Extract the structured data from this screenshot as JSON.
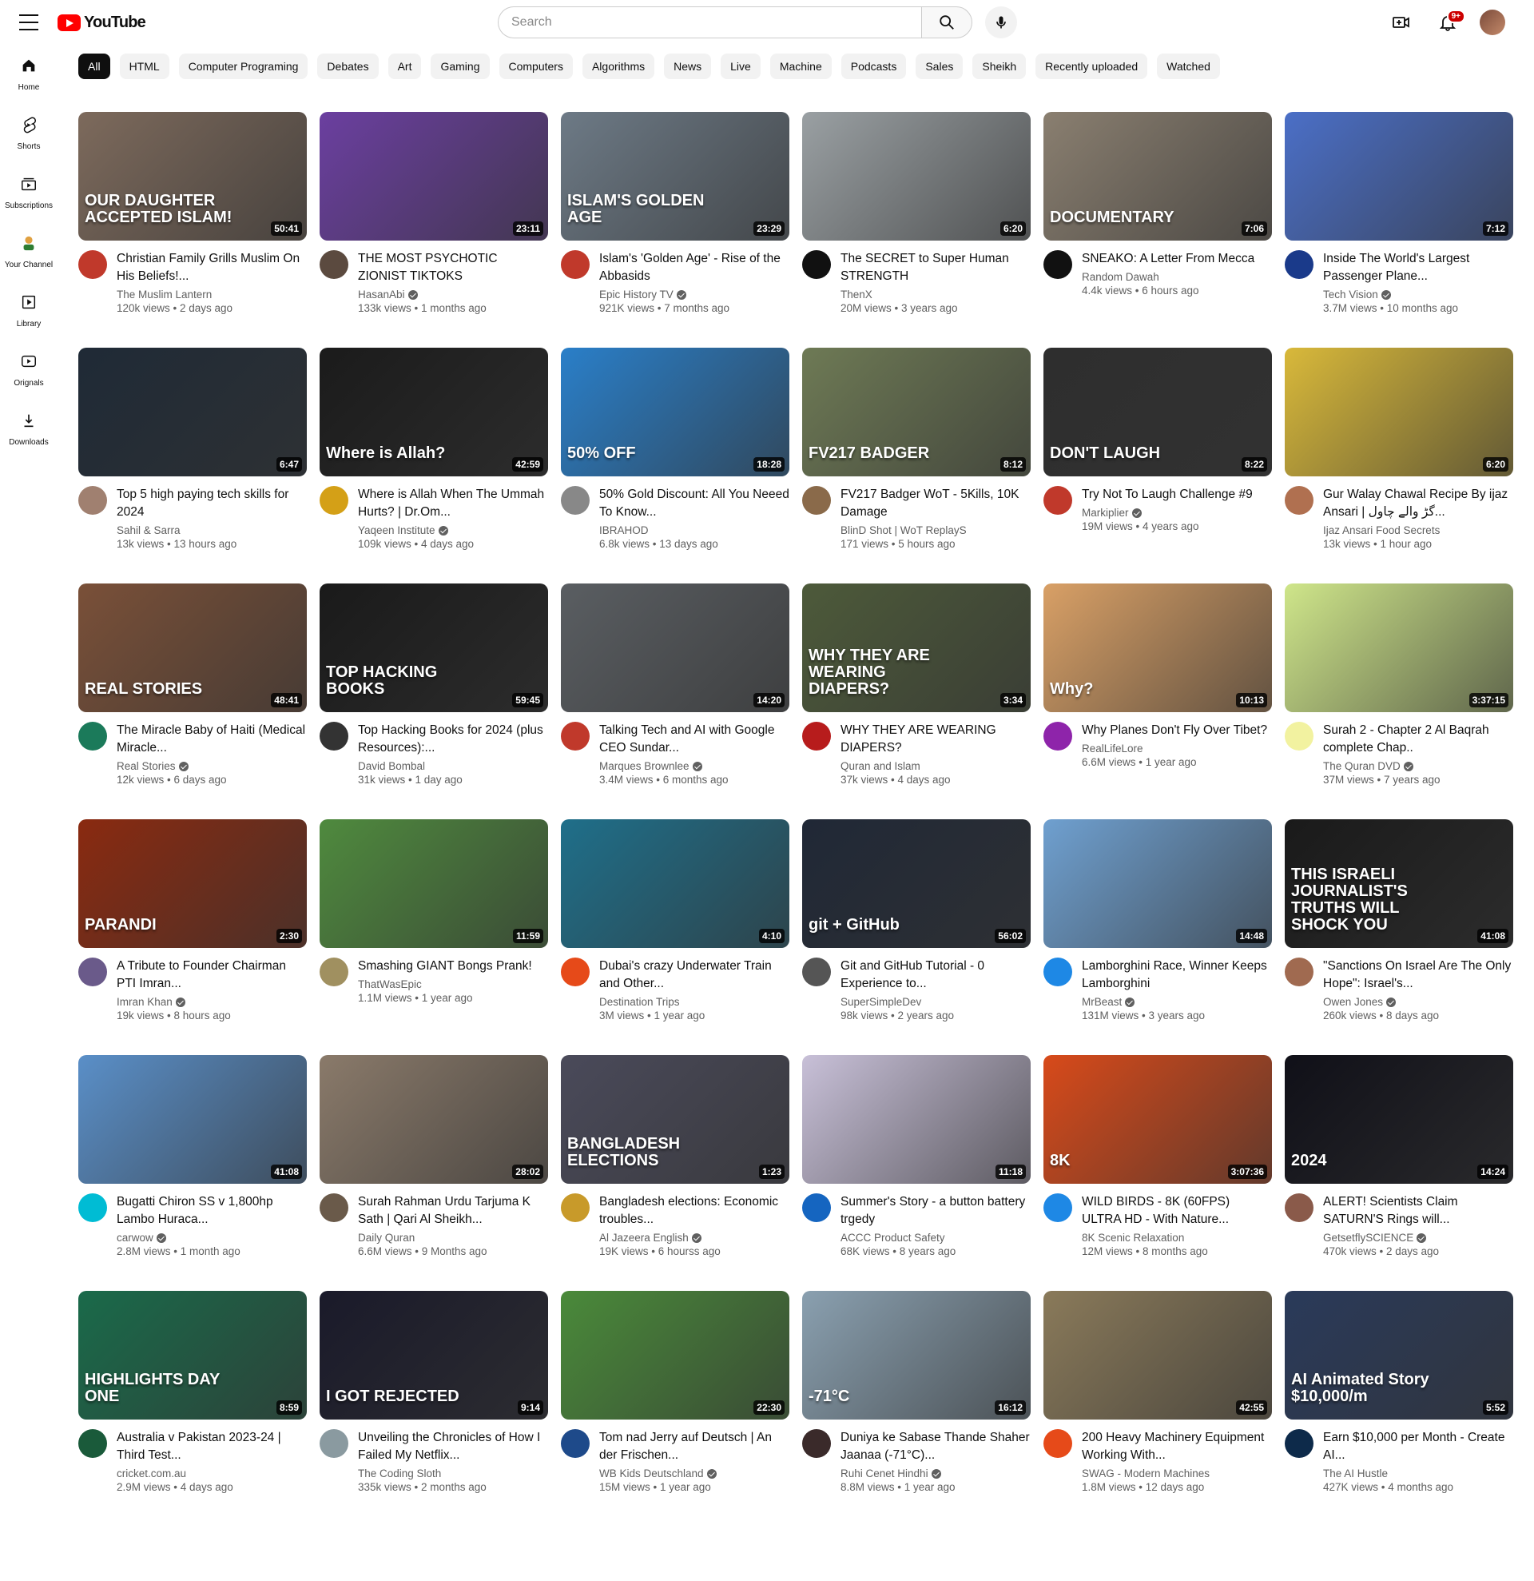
{
  "header": {
    "logo_text": "YouTube",
    "search_placeholder": "Search",
    "notification_count": "9+"
  },
  "sidebar": {
    "items": [
      {
        "label": "Home",
        "icon": "home-icon"
      },
      {
        "label": "Shorts",
        "icon": "shorts-icon"
      },
      {
        "label": "Subscriptions",
        "icon": "subscriptions-icon"
      },
      {
        "label": "Your Channel",
        "icon": "channel-icon"
      },
      {
        "label": "Library",
        "icon": "library-icon"
      },
      {
        "label": "Orignals",
        "icon": "originals-icon"
      },
      {
        "label": "Downloads",
        "icon": "downloads-icon"
      }
    ]
  },
  "chips": [
    "All",
    "HTML",
    "Computer Programing",
    "Debates",
    "Art",
    "Gaming",
    "Computers",
    "Algorithms",
    "News",
    "Live",
    "Machine",
    "Podcasts",
    "Sales",
    "Sheikh",
    "Recently uploaded",
    "Watched"
  ],
  "videos": [
    {
      "title": "Christian Family Grills Muslim On His Beliefs!...",
      "channel": "The Muslim Lantern",
      "verified": false,
      "stats": "120k views • 2 days ago",
      "duration": "50:41",
      "thumb_text": "OUR DAUGHTER ACCEPTED ISLAM!",
      "thumb_color": "#7d6a5c",
      "avatar_color": "#c0392b"
    },
    {
      "title": "THE MOST PSYCHOTIC ZIONIST TIKTOKS",
      "channel": "HasanAbi",
      "verified": true,
      "stats": "133k views • 1 months ago",
      "duration": "23:11",
      "thumb_text": "",
      "thumb_color": "#6b3fa0",
      "avatar_color": "#5b4a3f"
    },
    {
      "title": "Islam's 'Golden Age' - Rise of the Abbasids",
      "channel": "Epic History TV",
      "verified": true,
      "stats": "921K views • 7 months ago",
      "duration": "23:29",
      "thumb_text": "ISLAM'S GOLDEN AGE",
      "thumb_color": "#6d7a86",
      "avatar_color": "#c0392b"
    },
    {
      "title": "The SECRET to Super Human STRENGTH",
      "channel": "ThenX",
      "verified": false,
      "stats": "20M views • 3 years ago",
      "duration": "6:20",
      "thumb_text": "",
      "thumb_color": "#9aa0a3",
      "avatar_color": "#111111"
    },
    {
      "title": "SNEAKO: A Letter From Mecca",
      "channel": "Random Dawah",
      "verified": false,
      "stats": "4.4k views • 6 hours ago",
      "duration": "7:06",
      "thumb_text": "DOCUMENTARY",
      "thumb_color": "#8a7f70",
      "avatar_color": "#111111"
    },
    {
      "title": "Inside The World's Largest Passenger Plane...",
      "channel": "Tech Vision",
      "verified": true,
      "stats": "3.7M views • 10 months ago",
      "duration": "7:12",
      "thumb_text": "",
      "thumb_color": "#4b6fc7",
      "avatar_color": "#1a3a8a"
    },
    {
      "title": "Top 5 high paying tech skills for 2024",
      "channel": "Sahil & Sarra",
      "verified": false,
      "stats": "13k views • 13 hours ago",
      "duration": "6:47",
      "thumb_text": "",
      "thumb_color": "#1f2a36",
      "avatar_color": "#a08070"
    },
    {
      "title": "Where is Allah When The Ummah Hurts? | Dr.Om...",
      "channel": "Yaqeen Institute",
      "verified": true,
      "stats": "109k views • 4 days ago",
      "duration": "42:59",
      "thumb_text": "Where is Allah?",
      "thumb_color": "#1b1b1b",
      "avatar_color": "#d4a017"
    },
    {
      "title": "50% Gold Discount: All You Neeed To Know...",
      "channel": "IBRAHOD",
      "verified": false,
      "stats": "6.8k views • 13 days ago",
      "duration": "18:28",
      "thumb_text": "50% OFF",
      "thumb_color": "#2a7fc9",
      "avatar_color": "#888888"
    },
    {
      "title": "FV217 Badger WoT - 5Kills, 10K Damage",
      "channel": "BlinD Shot | WoT ReplayS",
      "verified": false,
      "stats": "171 views • 5 hours ago",
      "duration": "8:12",
      "thumb_text": "FV217 BADGER",
      "thumb_color": "#6e7a55",
      "avatar_color": "#8a6a4a"
    },
    {
      "title": "Try Not To Laugh Challenge #9",
      "channel": "Markiplier",
      "verified": true,
      "stats": "19M views • 4 years ago",
      "duration": "8:22",
      "thumb_text": "DON'T LAUGH",
      "thumb_color": "#2e2e2e",
      "avatar_color": "#c0392b"
    },
    {
      "title": "Gur Walay Chawal Recipe By ijaz Ansari | گڑ والے چاول...",
      "channel": "Ijaz Ansari Food Secrets",
      "verified": false,
      "stats": "13k views • 1 hour ago",
      "duration": "6:20",
      "thumb_text": "",
      "thumb_color": "#d9b93a",
      "avatar_color": "#b07050"
    },
    {
      "title": "The Miracle Baby of Haiti (Medical Miracle...",
      "channel": "Real Stories",
      "verified": true,
      "stats": "12k views • 6 days ago",
      "duration": "48:41",
      "thumb_text": "REAL STORIES",
      "thumb_color": "#7a5038",
      "avatar_color": "#1b7a5a"
    },
    {
      "title": "Top Hacking Books for 2024 (plus Resources):...",
      "channel": "David Bombal",
      "verified": false,
      "stats": "31k views • 1 day ago",
      "duration": "59:45",
      "thumb_text": "TOP HACKING BOOKS",
      "thumb_color": "#1a1a1a",
      "avatar_color": "#333333"
    },
    {
      "title": "Talking Tech and AI with Google CEO Sundar...",
      "channel": "Marques Brownlee",
      "verified": true,
      "stats": "3.4M views • 6 months ago",
      "duration": "14:20",
      "thumb_text": "",
      "thumb_color": "#5a5e62",
      "avatar_color": "#c0392b"
    },
    {
      "title": "WHY THEY ARE WEARING DIAPERS?",
      "channel": "Quran and Islam",
      "verified": false,
      "stats": "37k views • 4 days ago",
      "duration": "3:34",
      "thumb_text": "WHY THEY ARE WEARING DIAPERS?",
      "thumb_color": "#4d5a3a",
      "avatar_color": "#b71c1c"
    },
    {
      "title": "Why Planes Don't Fly Over Tibet?",
      "channel": "RealLifeLore",
      "verified": false,
      "stats": "6.6M views • 1 year ago",
      "duration": "10:13",
      "thumb_text": "Why?",
      "thumb_color": "#d9a066",
      "avatar_color": "#8e24aa"
    },
    {
      "title": "Surah 2 - Chapter 2 Al Baqrah complete Chap..",
      "channel": "The Quran DVD",
      "verified": true,
      "stats": "37M views • 7 years ago",
      "duration": "3:37:15",
      "thumb_text": "",
      "thumb_color": "#cfe68a",
      "avatar_color": "#f2f2a0"
    },
    {
      "title": "A Tribute to Founder Chairman PTI Imran...",
      "channel": "Imran Khan",
      "verified": true,
      "stats": "19k views • 8 hours ago",
      "duration": "2:30",
      "thumb_text": "PARANDI",
      "thumb_color": "#8a2a10",
      "avatar_color": "#6a5a8a"
    },
    {
      "title": "Smashing GIANT Bongs Prank!",
      "channel": "ThatWasEpic",
      "verified": false,
      "stats": "1.1M views • 1 year ago",
      "duration": "11:59",
      "thumb_text": "",
      "thumb_color": "#4f8a3e",
      "avatar_color": "#a09060"
    },
    {
      "title": "Dubai's crazy Underwater Train and Other...",
      "channel": "Destination Trips",
      "verified": false,
      "stats": "3M views • 1 year ago",
      "duration": "4:10",
      "thumb_text": "",
      "thumb_color": "#1f6f8a",
      "avatar_color": "#e64a19"
    },
    {
      "title": "Git and GitHub Tutorial - 0 Experience to...",
      "channel": "SuperSimpleDev",
      "verified": false,
      "stats": "98k views • 2 years ago",
      "duration": "56:02",
      "thumb_text": "git + GitHub",
      "thumb_color": "#202836",
      "avatar_color": "#555555"
    },
    {
      "title": "Lamborghini Race, Winner Keeps Lamborghini",
      "channel": "MrBeast",
      "verified": true,
      "stats": "131M views • 3 years ago",
      "duration": "14:48",
      "thumb_text": "",
      "thumb_color": "#6fa0d0",
      "avatar_color": "#1e88e5"
    },
    {
      "title": "\"Sanctions On Israel Are The Only Hope\": Israel's...",
      "channel": "Owen Jones",
      "verified": true,
      "stats": "260k views • 8 days ago",
      "duration": "41:08",
      "thumb_text": "THIS ISRAELI JOURNALIST'S TRUTHS WILL SHOCK YOU",
      "thumb_color": "#1a1a1a",
      "avatar_color": "#a06a50"
    },
    {
      "title": "Bugatti Chiron SS v 1,800hp Lambo Huraca...",
      "channel": "carwow",
      "verified": true,
      "stats": "2.8M views • 1 month ago",
      "duration": "41:08",
      "thumb_text": "",
      "thumb_color": "#5a8fc8",
      "avatar_color": "#00bcd4"
    },
    {
      "title": "Surah Rahman Urdu Tarjuma K Sath | Qari Al Sheikh...",
      "channel": "Daily Quran",
      "verified": false,
      "stats": "6.6M views • 9 Months ago",
      "duration": "28:02",
      "thumb_text": "",
      "thumb_color": "#8a7a6a",
      "avatar_color": "#6a5a4a"
    },
    {
      "title": "Bangladesh elections: Economic troubles...",
      "channel": "Al Jazeera English",
      "verified": true,
      "stats": "19K views • 6 hourss ago",
      "duration": "1:23",
      "thumb_text": "BANGLADESH ELECTIONS",
      "thumb_color": "#4a4a5a",
      "avatar_color": "#c89a2a"
    },
    {
      "title": "Summer's Story - a button battery trgedy",
      "channel": "ACCC Product Safety",
      "verified": false,
      "stats": "68K views • 8 years ago",
      "duration": "11:18",
      "thumb_text": "",
      "thumb_color": "#c8c0d8",
      "avatar_color": "#1565c0"
    },
    {
      "title": "WILD BIRDS - 8K (60FPS) ULTRA HD - With Nature...",
      "channel": "8K Scenic Relaxation",
      "verified": false,
      "stats": "12M views • 8 months ago",
      "duration": "3:07:36",
      "thumb_text": "8K",
      "thumb_color": "#d84a1a",
      "avatar_color": "#1e88e5"
    },
    {
      "title": "ALERT! Scientists Claim SATURN'S Rings will...",
      "channel": "GetsetflySCIENCE",
      "verified": true,
      "stats": "470k views • 2 days ago",
      "duration": "14:24",
      "thumb_text": "2024",
      "thumb_color": "#101018",
      "avatar_color": "#8a5a4a"
    },
    {
      "title": "Australia v Pakistan 2023-24 | Third Test...",
      "channel": "cricket.com.au",
      "verified": false,
      "stats": "2.9M views • 4 days ago",
      "duration": "8:59",
      "thumb_text": "HIGHLIGHTS DAY ONE",
      "thumb_color": "#1a6a4a",
      "avatar_color": "#1a5a3a"
    },
    {
      "title": "Unveiling the Chronicles of How I Failed My Netflix...",
      "channel": "The Coding Sloth",
      "verified": false,
      "stats": "335k views • 2 months ago",
      "duration": "9:14",
      "thumb_text": "I GOT REJECTED",
      "thumb_color": "#1a1a2a",
      "avatar_color": "#8a9aa0"
    },
    {
      "title": "Tom nad Jerry auf Deutsch | An der Frischen...",
      "channel": "WB Kids Deutschland",
      "verified": true,
      "stats": "15M views • 1 year ago",
      "duration": "22:30",
      "thumb_text": "",
      "thumb_color": "#4a8a3a",
      "avatar_color": "#1e4a8a"
    },
    {
      "title": "Duniya ke Sabase Thande Shaher Jaanaa (-71°C)...",
      "channel": "Ruhi Cenet Hindhi",
      "verified": true,
      "stats": "8.8M views • 1 year ago",
      "duration": "16:12",
      "thumb_text": "-71°C",
      "thumb_color": "#8aa0b0",
      "avatar_color": "#3a2a2a"
    },
    {
      "title": "200 Heavy Machinery Equipment Working With...",
      "channel": "SWAG - Modern Machines",
      "verified": false,
      "stats": "1.8M views • 12 days ago",
      "duration": "42:55",
      "thumb_text": "",
      "thumb_color": "#8a7a5a",
      "avatar_color": "#e64a19"
    },
    {
      "title": "Earn $10,000 per Month - Create AI...",
      "channel": "The AI Hustle",
      "verified": false,
      "stats": "427K views • 4 months ago",
      "duration": "5:52",
      "thumb_text": "AI Animated Story $10,000/m",
      "thumb_color": "#2a3a5a",
      "avatar_color": "#0d2a4a"
    }
  ]
}
